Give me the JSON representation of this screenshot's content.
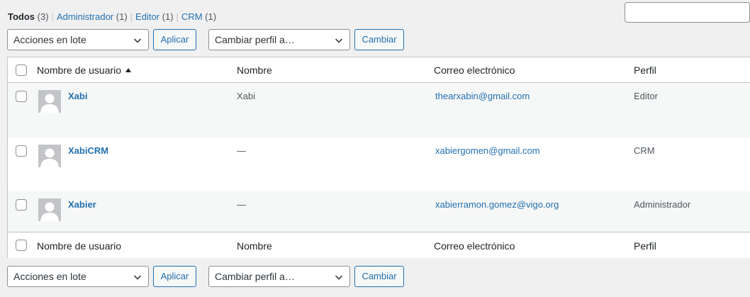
{
  "filters": {
    "all": {
      "label": "Todos",
      "count": "(3)"
    },
    "items": [
      {
        "label": "Administrador",
        "count": "(1)"
      },
      {
        "label": "Editor",
        "count": "(1)"
      },
      {
        "label": "CRM",
        "count": "(1)"
      }
    ],
    "separator": "|"
  },
  "search": {
    "value": ""
  },
  "tablenav": {
    "bulk_actions": "Acciones en lote",
    "apply_label": "Aplicar",
    "change_role": "Cambiar perfil a…",
    "change_label": "Cambiar"
  },
  "columns": {
    "username": "Nombre de usuario",
    "name": "Nombre",
    "email": "Correo electrónico",
    "role": "Perfil"
  },
  "rows": [
    {
      "username": "Xabi",
      "name": "Xabi",
      "email": "thearxabin@gmail.com",
      "role": "Editor"
    },
    {
      "username": "XabiCRM",
      "name": "—",
      "email": "xabiergomen@gmail.com",
      "role": "CRM"
    },
    {
      "username": "Xabier",
      "name": "—",
      "email": "xabierramon.gomez@vigo.org",
      "role": "Administrador"
    }
  ],
  "icons": {
    "sort": "sort-ascending-icon",
    "dropdown": "chevron-down-icon",
    "avatar": "default-avatar-icon"
  }
}
